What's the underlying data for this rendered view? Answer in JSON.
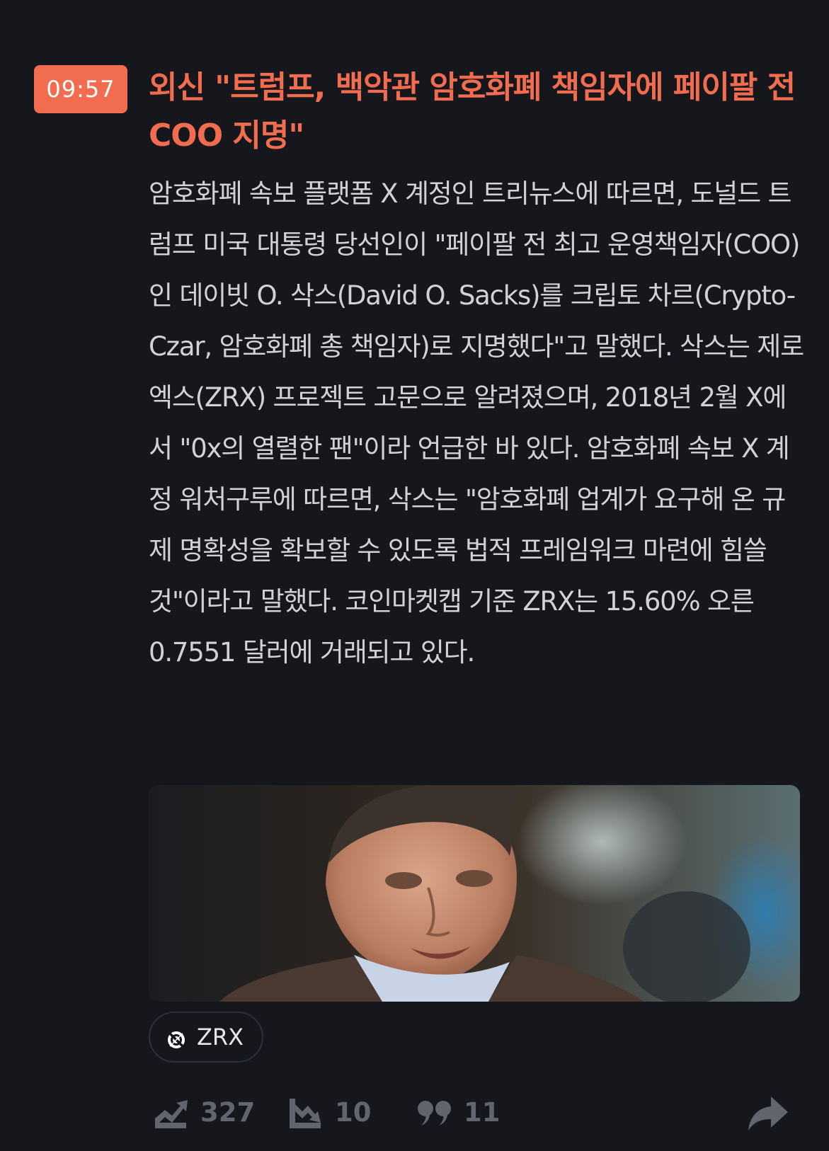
{
  "post": {
    "time": "09:57",
    "headline": "외신 \"트럼프, 백악관 암호화폐 책임자에 페이팔 전 COO 지명\"",
    "body": "암호화폐 속보 플랫폼 X 계정인 트리뉴스에 따르면, 도널드 트럼프 미국 대통령 당선인이 \"페이팔 전 최고 운영책임자(COO)인 데이빗 O. 삭스(David O. Sacks)를 크립토 차르(Crypto-Czar, 암호화폐 총 책임자)로 지명했다\"고 말했다. 삭스는 제로엑스(ZRX) 프로젝트 고문으로 알려졌으며, 2018년 2월 X에서 \"0x의 열렬한 팬\"이라 언급한 바 있다. 암호화폐 속보 X 계정 워처구루에 따르면, 삭스는 \"암호화폐 업계가 요구해 온 규제 명확성을 확보할 수 있도록 법적 프레임워크 마련에 힘쓸 것\"이라고 말했다. 코인마켓캡 기준 ZRX는 15.60% 오른 0.7551 달러에 거래되고 있다."
  },
  "tag": {
    "label": "ZRX",
    "icon": "zrx-coin-icon"
  },
  "actions": {
    "bullish_count": "327",
    "bearish_count": "10",
    "comment_count": "11",
    "bullish_icon": "trend-up-icon",
    "bearish_icon": "trend-down-icon",
    "comment_icon": "quote-icon",
    "share_icon": "share-arrow-icon"
  },
  "colors": {
    "background": "#15171c",
    "accent": "#f26d4f",
    "body_text": "#d0d2d8",
    "muted": "#62656e"
  }
}
